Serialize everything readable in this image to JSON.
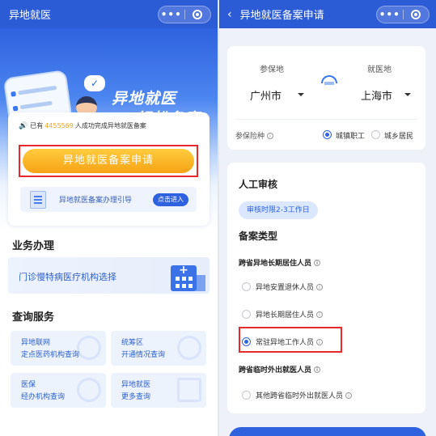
{
  "left": {
    "title": "异地就医",
    "slogan_line1": "异地就医",
    "slogan_line2": "轻松备案",
    "notice_pre": "已有",
    "notice_count": "4455569",
    "notice_post": "人成功完成异地就医备案",
    "apply_button": "异地就医备案申请",
    "guide_text": "异地就医备案办理引导",
    "guide_button": "点击进入",
    "business_title": "业务办理",
    "business_item": "门诊慢特病医疗机构选择",
    "query_title": "查询服务",
    "query_items": [
      {
        "line1": "异地联网",
        "line2": "定点医药机构查询"
      },
      {
        "line1": "统筹区",
        "line2": "开通情况查询"
      },
      {
        "line1": "医保",
        "line2": "经办机构查询"
      },
      {
        "line1": "异地就医",
        "line2": "更多查询"
      }
    ]
  },
  "right": {
    "title": "异地就医备案申请",
    "insured_label": "参保地",
    "insured_city": "广州市",
    "treat_label": "就医地",
    "treat_city": "上海市",
    "type_label": "参保险种",
    "type_options": [
      "城镇职工",
      "城乡居民"
    ],
    "type_selected": "城镇职工",
    "review_title": "人工审核",
    "review_chip": "审核时限2-3工作日",
    "filing_type_title": "备案类型",
    "group1_title": "跨省异地长期居住人员",
    "group1_options": [
      "异地安置退休人员",
      "异地长期居住人员",
      "常驻异地工作人员"
    ],
    "group1_selected": "常驻异地工作人员",
    "group2_title": "跨省临时外出就医人员",
    "group2_options": [
      "其他跨省临时外出就医人员"
    ]
  },
  "colors": {
    "brand": "#2c5bd6",
    "accent": "#f6a315",
    "highlight": "#e8282b"
  }
}
